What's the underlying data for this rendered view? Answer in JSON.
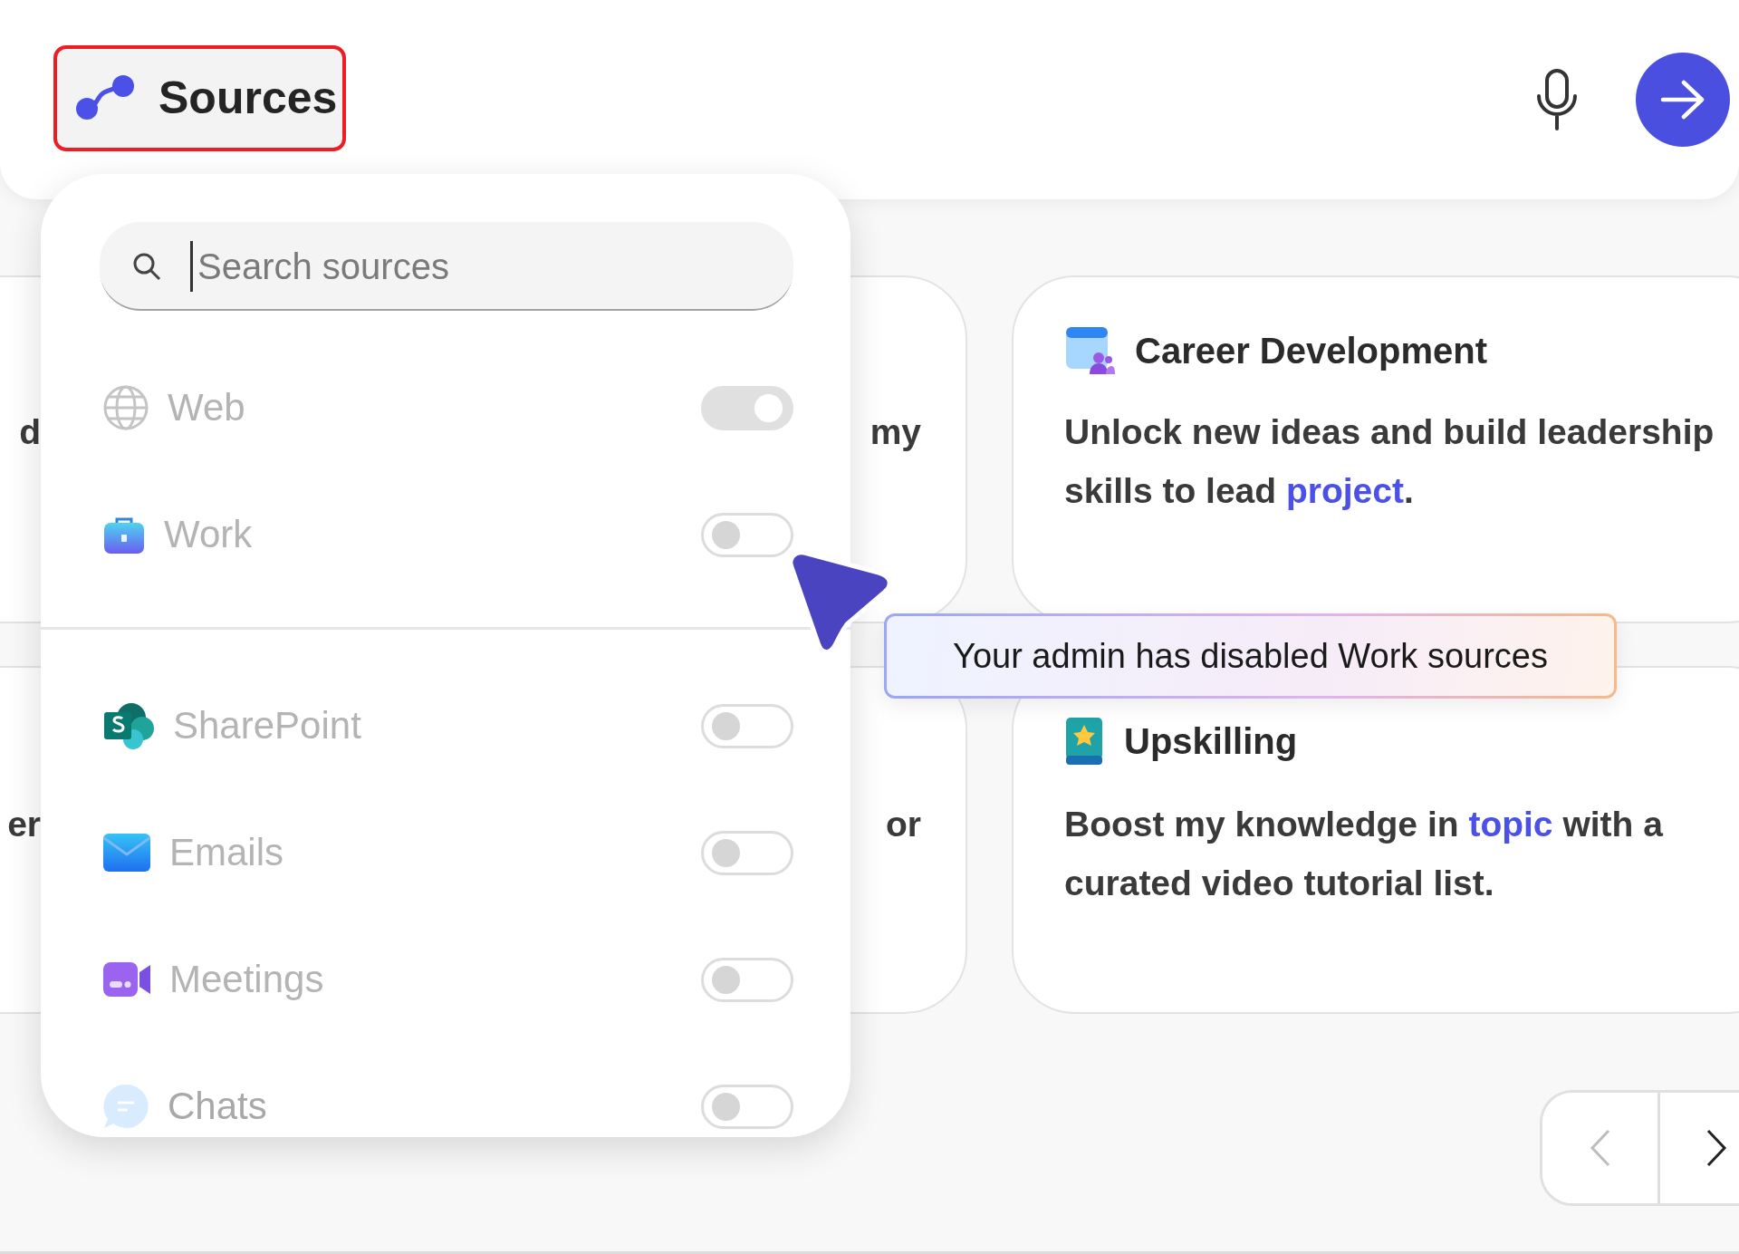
{
  "sources_button": {
    "label": "Sources"
  },
  "source_panel": {
    "search": {
      "placeholder": "Search sources"
    },
    "groups": [
      {
        "items": [
          {
            "label": "Web",
            "on": true,
            "disabled": true
          },
          {
            "label": "Work",
            "on": false,
            "disabled": true
          }
        ]
      },
      {
        "items": [
          {
            "label": "SharePoint",
            "on": false,
            "disabled": true
          },
          {
            "label": "Emails",
            "on": false,
            "disabled": true
          },
          {
            "label": "Meetings",
            "on": false,
            "disabled": true
          },
          {
            "label": "Chats",
            "on": false,
            "disabled": true
          }
        ]
      }
    ]
  },
  "tooltip": {
    "text": "Your admin has disabled Work sources"
  },
  "card_rows": [
    {
      "cards": [
        {
          "kind": "partial",
          "text": "d"
        },
        {
          "kind": "partial",
          "text": "my"
        },
        {
          "kind": "full",
          "title": "Career Development",
          "body": [
            {
              "text": "Unlock new ideas and build leadership skills to lead "
            },
            {
              "text": "project",
              "kind": "slot"
            },
            {
              "text": "."
            }
          ]
        }
      ]
    },
    {
      "cards": [
        {
          "kind": "partial",
          "text": "er"
        },
        {
          "kind": "partial",
          "text": "or"
        },
        {
          "kind": "full",
          "title": "Upskilling",
          "body": [
            {
              "text": "Boost my knowledge in "
            },
            {
              "text": "topic",
              "kind": "slot"
            },
            {
              "text": " with a curated video tutorial list."
            }
          ]
        }
      ]
    }
  ],
  "pager": {
    "prev_disabled": true,
    "next_disabled": false
  }
}
